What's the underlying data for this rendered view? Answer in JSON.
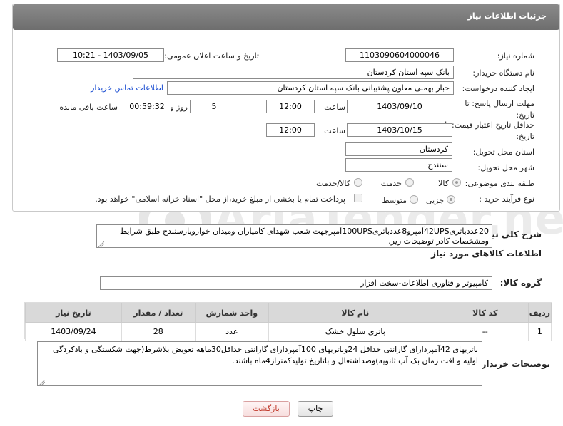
{
  "header": {
    "title": "جزئیات اطلاعات نیاز"
  },
  "form": {
    "need_number_label": "شماره نیاز:",
    "need_number": "1103090604000046",
    "announce_label": "تاریخ و ساعت اعلان عمومی:",
    "announce_value": "1403/09/05 - 10:21",
    "buyer_org_label": "نام دستگاه خریدار:",
    "buyer_org": "بانک سپه استان کردستان",
    "creator_label": "ایجاد کننده درخواست:",
    "creator": "جبار بهمنی معاون پشتیبانی بانک سپه استان کردستان",
    "contact_link": "اطلاعات تماس خریدار",
    "deadline_label": "مهلت ارسال پاسخ: تا تاریخ:",
    "deadline_date": "1403/09/10",
    "time_label": "ساعت",
    "deadline_time": "12:00",
    "days_value": "5",
    "days_label": "روز و",
    "remaining_time": "00:59:32",
    "remaining_label": "ساعت باقی مانده",
    "validity_label": "حداقل تاریخ اعتبار قیمت: تا تاریخ:",
    "validity_date": "1403/10/15",
    "validity_time": "12:00",
    "province_label": "استان محل تحویل:",
    "province": "کردستان",
    "city_label": "شهر محل تحویل:",
    "city": "سنندج",
    "category_label": "طبقه بندی موضوعی:",
    "category_options": [
      "کالا",
      "خدمت",
      "کالا/خدمت"
    ],
    "process_label": "نوع فرآیند خرید :",
    "process_options": [
      "جزیی",
      "متوسط"
    ],
    "process_note": "پرداخت تمام یا بخشی از مبلغ خرید،از محل \"اسناد خزانه اسلامی\" خواهد بود."
  },
  "description": {
    "label": "شرح کلی نیاز:",
    "text": "20عددباتری42UPSآمپرو8عددباتری100UPSآمپرجهت شعب شهدای کامیاران ومیدان خواروبارسنندج طبق شرایط ومشخصات کادر توضیحات زیر."
  },
  "goods": {
    "section_title": "اطلاعات کالاهای مورد نیاز",
    "group_label": "گروه کالا:",
    "group_value": "کامپیوتر و فناوری اطلاعات-سخت افزار",
    "table": {
      "headers": [
        "ردیف",
        "کد کالا",
        "نام کالا",
        "واحد شمارش",
        "تعداد / مقدار",
        "تاریخ نیاز"
      ],
      "rows": [
        {
          "row": "1",
          "code": "--",
          "name": "باتری سلول خشک",
          "unit": "عدد",
          "qty": "28",
          "date": "1403/09/24"
        }
      ]
    }
  },
  "buyer_notes": {
    "label": "توضیحات خریدار:",
    "text": "باتریهای 42آمپردارای گارانتی حداقل 24وباتریهای 100آمپردارای گارانتی حداقل30ماهه تعویض بلاشرط(جهت شکستگی و بادکردگی اولیه و افت زمان بک آپ ثانویه)وضداشتعال و باتاریخ تولیدکمتراز4ماه باشند."
  },
  "buttons": {
    "print": "چاپ",
    "back": "بازگشت"
  },
  "watermark": "AriaTender.neT",
  "colors": {
    "header_bg": "#7a7a7a",
    "link": "#1a4dd1",
    "back_button": "#c0392b"
  }
}
